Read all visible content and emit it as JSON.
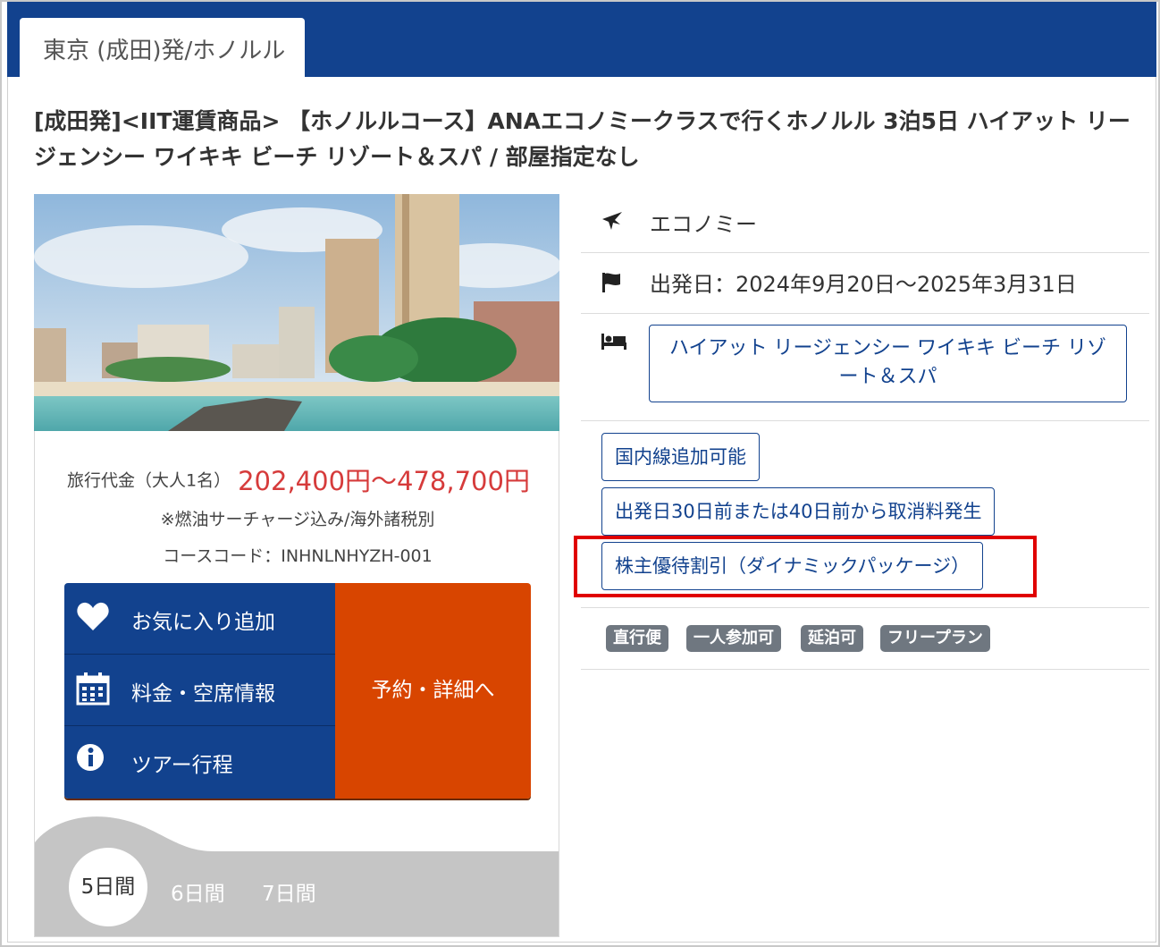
{
  "tab": {
    "label": "東京 (成田)発/ホノルル"
  },
  "tour": {
    "title": "[成田発]<IIT運賃商品> 【ホノルルコース】ANAエコノミークラスで行くホノルル 3泊5日 ハイアット リージェンシー ワイキキ ビーチ リゾート＆スパ / 部屋指定なし",
    "price_label": "旅行代金（大人1名）",
    "price": "202,400円〜478,700円",
    "fuel_note": "※燃油サーチャージ込み/海外諸税別",
    "course_code": "コースコード：INHNLNHYZH-001"
  },
  "actions": {
    "favorite": "お気に入り追加",
    "fares": "料金・空席情報",
    "itinerary": "ツアー行程",
    "reserve": "予約・詳細へ"
  },
  "durations": {
    "selected": "5日間",
    "options": [
      "6日間",
      "7日間"
    ]
  },
  "info": {
    "cabin": "エコノミー",
    "departure": "出発日：2024年9月20日〜2025年3月31日",
    "hotel": "ハイアット リージェンシー ワイキキ ビーチ リゾート＆スパ"
  },
  "conditions": [
    "国内線追加可能",
    "出発日30日前または40日前から取消料発生",
    "株主優待割引（ダイナミックパッケージ）"
  ],
  "features": [
    "直行便",
    "一人参加可",
    "延泊可",
    "フリープラン"
  ],
  "colors": {
    "brand_blue": "#12428e",
    "reserve_orange": "#d84500",
    "price_red": "#d63b3b",
    "highlight_red": "#e00000"
  },
  "icons": {
    "cabin": "airplane-icon",
    "departure": "flag-icon",
    "hotel": "bed-icon",
    "favorite": "heart-icon",
    "fares": "calendar-icon",
    "itinerary": "info-icon"
  }
}
